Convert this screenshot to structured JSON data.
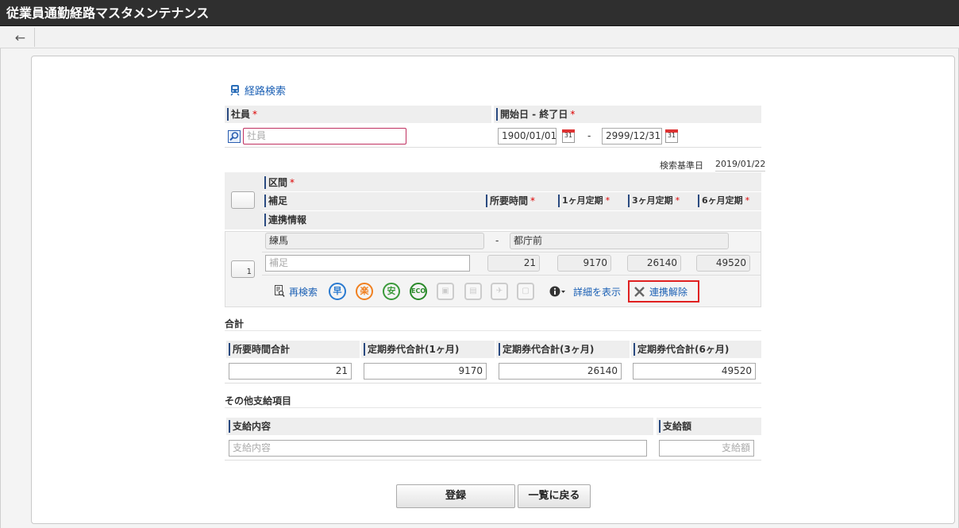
{
  "app": {
    "title": "従業員通勤経路マスタメンテナンス"
  },
  "toolbar": {
    "back_icon": "←"
  },
  "search": {
    "link": "経路検索"
  },
  "employee": {
    "header": "社員",
    "required": "*",
    "placeholder": "社員"
  },
  "period": {
    "header": "開始日 - 終了日",
    "required": "*",
    "start": "1900/01/01",
    "separator": "-",
    "end": "2999/12/31",
    "cal_label": "31"
  },
  "base_date": {
    "label": "検索基準日",
    "value": "2019/01/22"
  },
  "route_headers": {
    "section": "区間",
    "note": "補足",
    "time": "所要時間",
    "one_month": "1ヶ月定期",
    "three_month": "3ヶ月定期",
    "six_month": "6ヶ月定期",
    "link_info": "連携情報",
    "req": "*"
  },
  "route": {
    "row_no": "1",
    "from": "練馬",
    "separator": "-",
    "to": "都庁前",
    "note_placeholder": "補足",
    "time": "21",
    "one_month": "9170",
    "three_month": "26140",
    "six_month": "49520",
    "actions": {
      "research": "再検索",
      "early": "早",
      "easy": "楽",
      "cheap": "安",
      "eco": "ECO",
      "detail": "詳細を表示",
      "unlink": "連携解除"
    }
  },
  "totals": {
    "title": "合計",
    "headers": [
      "所要時間合計",
      "定期券代合計(1ヶ月)",
      "定期券代合計(3ヶ月)",
      "定期券代合計(6ヶ月)"
    ],
    "values": [
      "21",
      "9170",
      "26140",
      "49520"
    ]
  },
  "other": {
    "title": "その他支給項目",
    "content_header": "支給内容",
    "content_placeholder": "支給内容",
    "amount_header": "支給額",
    "amount_placeholder": "支給額"
  },
  "buttons": {
    "register": "登録",
    "back_to_list": "一覧に戻る"
  }
}
